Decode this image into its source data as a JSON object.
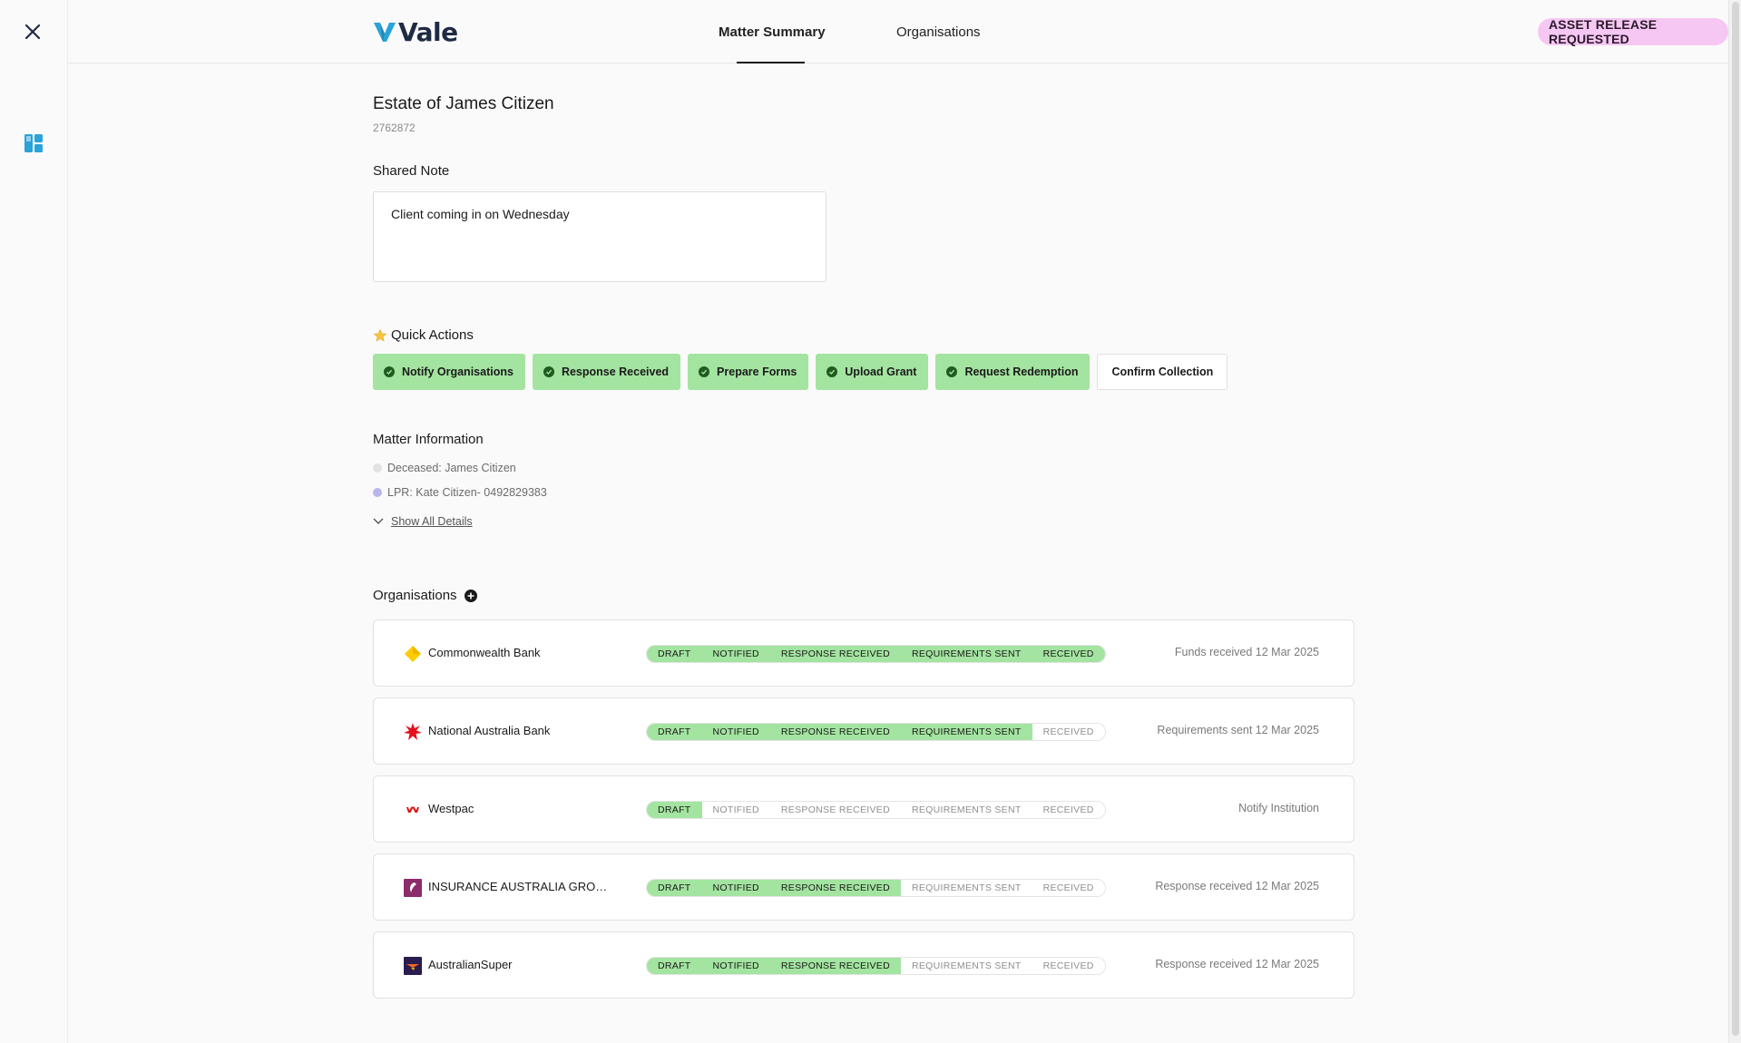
{
  "app": {
    "logo_text": "Vale",
    "brand_color": "#2aa3d8"
  },
  "header": {
    "tabs": [
      {
        "label": "Matter Summary",
        "active": true
      },
      {
        "label": "Organisations",
        "active": false
      }
    ],
    "status_badge": "ASSET RELEASE REQUESTED",
    "status_badge_color": "#f6c7f3"
  },
  "matter": {
    "title": "Estate of James Citizen",
    "number": "2762872"
  },
  "shared_note": {
    "label": "Shared Note",
    "value": "Client coming in on Wednesday"
  },
  "quick_actions": {
    "label": "Quick Actions",
    "icon": "star-icon",
    "items": [
      {
        "label": "Notify Organisations",
        "done": true
      },
      {
        "label": "Response Received",
        "done": true
      },
      {
        "label": "Prepare Forms",
        "done": true
      },
      {
        "label": "Upload Grant",
        "done": true
      },
      {
        "label": "Request Redemption",
        "done": true
      },
      {
        "label": "Confirm Collection",
        "done": false
      }
    ],
    "done_color": "#a3e4a0"
  },
  "matter_information": {
    "label": "Matter Information",
    "items": [
      {
        "text": "Deceased: James Citizen",
        "dot_color": "#e2e2e2"
      },
      {
        "text": "LPR: Kate Citizen- 0492829383",
        "dot_color": "#b9b5ef"
      }
    ],
    "show_all_label": "Show All Details"
  },
  "organisations": {
    "label": "Organisations",
    "stage_labels": [
      "DRAFT",
      "NOTIFIED",
      "RESPONSE RECEIVED",
      "REQUIREMENTS SENT",
      "RECEIVED"
    ],
    "rows": [
      {
        "name": "Commonwealth Bank",
        "icon": "commonwealth-bank-icon",
        "stages_complete": 5,
        "status": "Funds received 12 Mar 2025"
      },
      {
        "name": "National Australia Bank",
        "icon": "nab-star-icon",
        "stages_complete": 4,
        "status": "Requirements sent 12 Mar 2025"
      },
      {
        "name": "Westpac",
        "icon": "westpac-icon",
        "stages_complete": 1,
        "status": "Notify Institution"
      },
      {
        "name": "INSURANCE AUSTRALIA GROUP...",
        "icon": "iag-icon",
        "stages_complete": 3,
        "status": "Response received 12 Mar 2025"
      },
      {
        "name": "AustralianSuper",
        "icon": "australiansuper-icon",
        "stages_complete": 3,
        "status": "Response received 12 Mar 2025"
      }
    ]
  }
}
